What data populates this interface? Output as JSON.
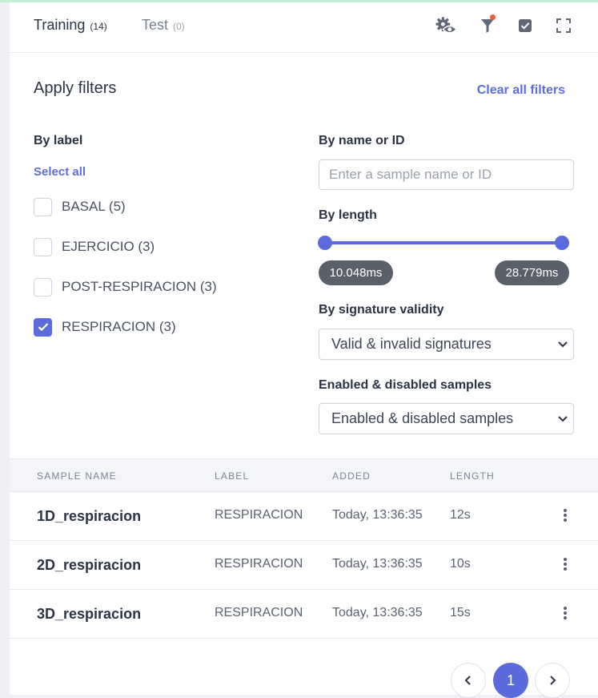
{
  "tabs": [
    {
      "label": "Training",
      "count": "(14)"
    },
    {
      "label": "Test",
      "count": "(0)"
    }
  ],
  "header_icons": [
    "eye-settings-icon",
    "filter-icon",
    "checkbox-icon",
    "fullscreen-icon"
  ],
  "filters": {
    "title": "Apply filters",
    "clear_label": "Clear all filters",
    "by_label": {
      "heading": "By label",
      "select_all": "Select all",
      "options": [
        {
          "label": "BASAL (5)",
          "checked": false
        },
        {
          "label": "EJERCICIO (3)",
          "checked": false
        },
        {
          "label": "POST-RESPIRACION (3)",
          "checked": false
        },
        {
          "label": "RESPIRACION (3)",
          "checked": true
        }
      ]
    },
    "by_name": {
      "heading": "By name or ID",
      "placeholder": "Enter a sample name or ID",
      "value": ""
    },
    "by_length": {
      "heading": "By length",
      "min_label": "10.048ms",
      "max_label": "28.779ms"
    },
    "by_signature": {
      "heading": "By signature validity",
      "selected": "Valid & invalid signatures"
    },
    "enabled": {
      "heading": "Enabled & disabled samples",
      "selected": "Enabled & disabled samples"
    }
  },
  "table": {
    "columns": [
      "SAMPLE NAME",
      "LABEL",
      "ADDED",
      "LENGTH"
    ],
    "rows": [
      {
        "name": "1D_respiracion",
        "label": "RESPIRACION",
        "added": "Today, 13:36:35",
        "length": "12s"
      },
      {
        "name": "2D_respiracion",
        "label": "RESPIRACION",
        "added": "Today, 13:36:35",
        "length": "10s"
      },
      {
        "name": "3D_respiracion",
        "label": "RESPIRACION",
        "added": "Today, 13:36:35",
        "length": "15s"
      }
    ]
  },
  "pagination": {
    "current_page": "1"
  },
  "colors": {
    "accent": "#5b6bdc",
    "notification_dot": "#ef5a3c",
    "pill_bg": "#595f6b"
  }
}
